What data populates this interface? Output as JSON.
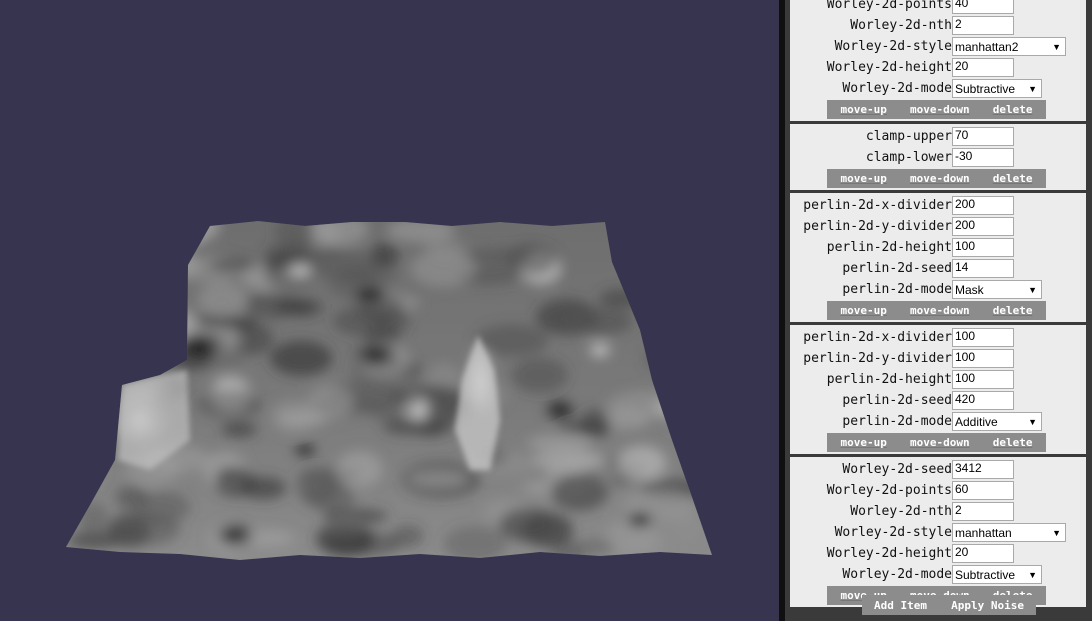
{
  "cards": [
    {
      "rows": [
        {
          "label": "Worley-2d-points",
          "type": "input",
          "value": "40",
          "w": 62
        },
        {
          "label": "Worley-2d-nth",
          "type": "input",
          "value": "2",
          "w": 62
        },
        {
          "label": "Worley-2d-style",
          "type": "select",
          "value": "manhattan2",
          "w": 114
        },
        {
          "label": "Worley-2d-height",
          "type": "input",
          "value": "20",
          "w": 62
        },
        {
          "label": "Worley-2d-mode",
          "type": "select",
          "value": "Subtractive",
          "w": 90
        }
      ]
    },
    {
      "rows": [
        {
          "label": "clamp-upper",
          "type": "input",
          "value": "70",
          "w": 62
        },
        {
          "label": "clamp-lower",
          "type": "input",
          "value": "-30",
          "w": 62
        }
      ]
    },
    {
      "rows": [
        {
          "label": "perlin-2d-x-divider",
          "type": "input",
          "value": "200",
          "w": 62
        },
        {
          "label": "perlin-2d-y-divider",
          "type": "input",
          "value": "200",
          "w": 62
        },
        {
          "label": "perlin-2d-height",
          "type": "input",
          "value": "100",
          "w": 62
        },
        {
          "label": "perlin-2d-seed",
          "type": "input",
          "value": "14",
          "w": 62
        },
        {
          "label": "perlin-2d-mode",
          "type": "select",
          "value": "Mask",
          "w": 90
        }
      ]
    },
    {
      "rows": [
        {
          "label": "perlin-2d-x-divider",
          "type": "input",
          "value": "100",
          "w": 62
        },
        {
          "label": "perlin-2d-y-divider",
          "type": "input",
          "value": "100",
          "w": 62
        },
        {
          "label": "perlin-2d-height",
          "type": "input",
          "value": "100",
          "w": 62
        },
        {
          "label": "perlin-2d-seed",
          "type": "input",
          "value": "420",
          "w": 62
        },
        {
          "label": "perlin-2d-mode",
          "type": "select",
          "value": "Additive",
          "w": 90
        }
      ]
    },
    {
      "rows": [
        {
          "label": "Worley-2d-seed",
          "type": "input",
          "value": "3412",
          "w": 62
        },
        {
          "label": "Worley-2d-points",
          "type": "input",
          "value": "60",
          "w": 62
        },
        {
          "label": "Worley-2d-nth",
          "type": "input",
          "value": "2",
          "w": 62
        },
        {
          "label": "Worley-2d-style",
          "type": "select",
          "value": "manhattan",
          "w": 114
        },
        {
          "label": "Worley-2d-height",
          "type": "input",
          "value": "20",
          "w": 62
        },
        {
          "label": "Worley-2d-mode",
          "type": "select",
          "value": "Subtractive",
          "w": 90
        }
      ]
    }
  ],
  "buttons": {
    "move_up": "move-up",
    "move_down": "move-down",
    "delete": "delete"
  },
  "footer": {
    "add": "Add Item",
    "apply": "Apply Noise"
  },
  "colors": {
    "background": "#36344f",
    "panel": "#3a3a3a",
    "card": "#ececec",
    "button_bar": "#8c8c8c"
  }
}
